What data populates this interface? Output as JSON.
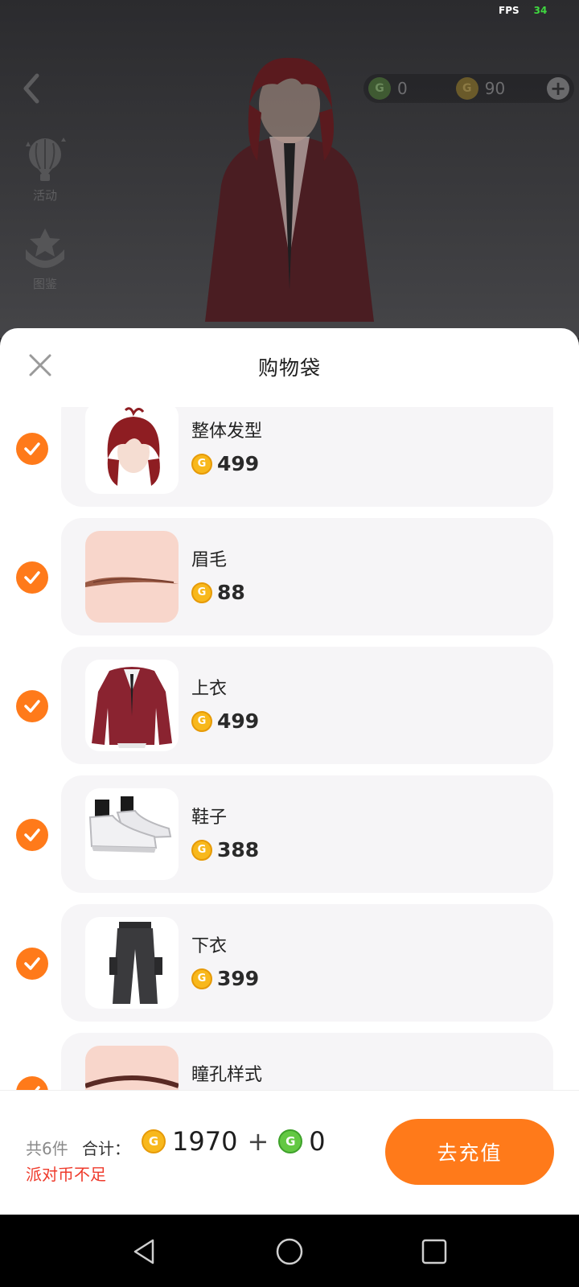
{
  "status": {
    "fps_label": "FPS",
    "fps_value": "34"
  },
  "backdrop": {
    "side_entries": [
      {
        "label": "活动",
        "icon": "hot-air-balloon-icon"
      },
      {
        "label": "图鉴",
        "icon": "star-badge-icon"
      }
    ],
    "currency": {
      "g_coin": "0",
      "party_coin": "90",
      "add_icon": "plus-icon"
    }
  },
  "sheet": {
    "title": "购物袋",
    "close_icon": "close-icon",
    "items": [
      {
        "name": "整体发型",
        "price": "499",
        "checked": true,
        "thumb": "red-hair"
      },
      {
        "name": "眉毛",
        "price": "88",
        "checked": true,
        "thumb": "eyebrow"
      },
      {
        "name": "上衣",
        "price": "499",
        "checked": true,
        "thumb": "red-cardigan"
      },
      {
        "name": "鞋子",
        "price": "388",
        "checked": true,
        "thumb": "white-sneakers"
      },
      {
        "name": "下衣",
        "price": "399",
        "checked": true,
        "thumb": "black-cargo-pants"
      },
      {
        "name": "瞳孔样式",
        "price": "",
        "checked": true,
        "thumb": "pupil"
      }
    ]
  },
  "footer": {
    "count_text": "共6件",
    "total_label": "合计：",
    "total_party_coin": "1970",
    "plus": "+",
    "total_g_coin": "0",
    "warning": "派对币不足",
    "recharge_button": "去充值"
  },
  "colors": {
    "accent": "#ff7a1a",
    "warning": "#ef3b2c",
    "coin": "#f8b81c",
    "g_coin": "#63c843"
  },
  "navbar": {
    "icons": [
      "back-triangle-icon",
      "home-circle-icon",
      "recents-square-icon"
    ]
  }
}
